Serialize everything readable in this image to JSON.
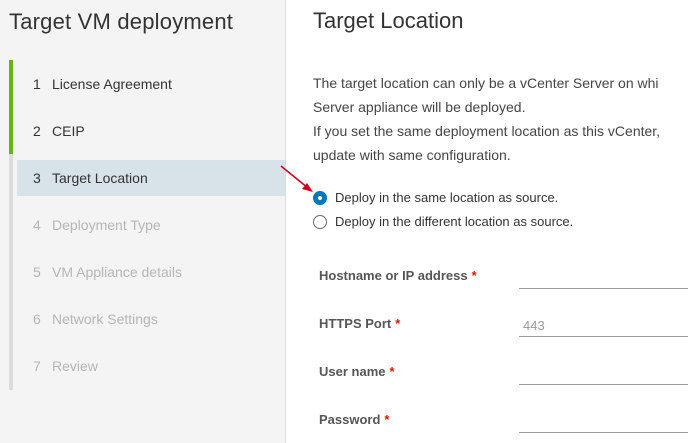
{
  "sidebar": {
    "title": "Target VM deployment",
    "steps": [
      {
        "num": "1",
        "label": "License Agreement"
      },
      {
        "num": "2",
        "label": "CEIP"
      },
      {
        "num": "3",
        "label": "Target Location"
      },
      {
        "num": "4",
        "label": "Deployment Type"
      },
      {
        "num": "5",
        "label": "VM Appliance details"
      },
      {
        "num": "6",
        "label": "Network Settings"
      },
      {
        "num": "7",
        "label": "Review"
      }
    ]
  },
  "main": {
    "title": "Target Location",
    "description": [
      "The target location can only be a vCenter Server on whi",
      "Server appliance will be deployed.",
      "If you set the same deployment location as this vCenter,",
      "update with same configuration."
    ],
    "radios": [
      {
        "label": "Deploy in the same location as source.",
        "checked": true
      },
      {
        "label": "Deploy in the different location as source.",
        "checked": false
      }
    ],
    "fields": {
      "hostname": {
        "label": "Hostname or IP address",
        "value": "",
        "placeholder": ""
      },
      "https_port": {
        "label": "HTTPS Port",
        "value": "",
        "placeholder": "443"
      },
      "username": {
        "label": "User name",
        "value": "",
        "placeholder": ""
      },
      "password": {
        "label": "Password",
        "value": "",
        "placeholder": ""
      },
      "required_marker": "*"
    }
  },
  "colors": {
    "accent": "#0079b8",
    "completed_step": "#5eb715",
    "active_step_bg": "#d8e3e9",
    "required": "#c92100",
    "annotation_arrow": "#d0021b"
  }
}
